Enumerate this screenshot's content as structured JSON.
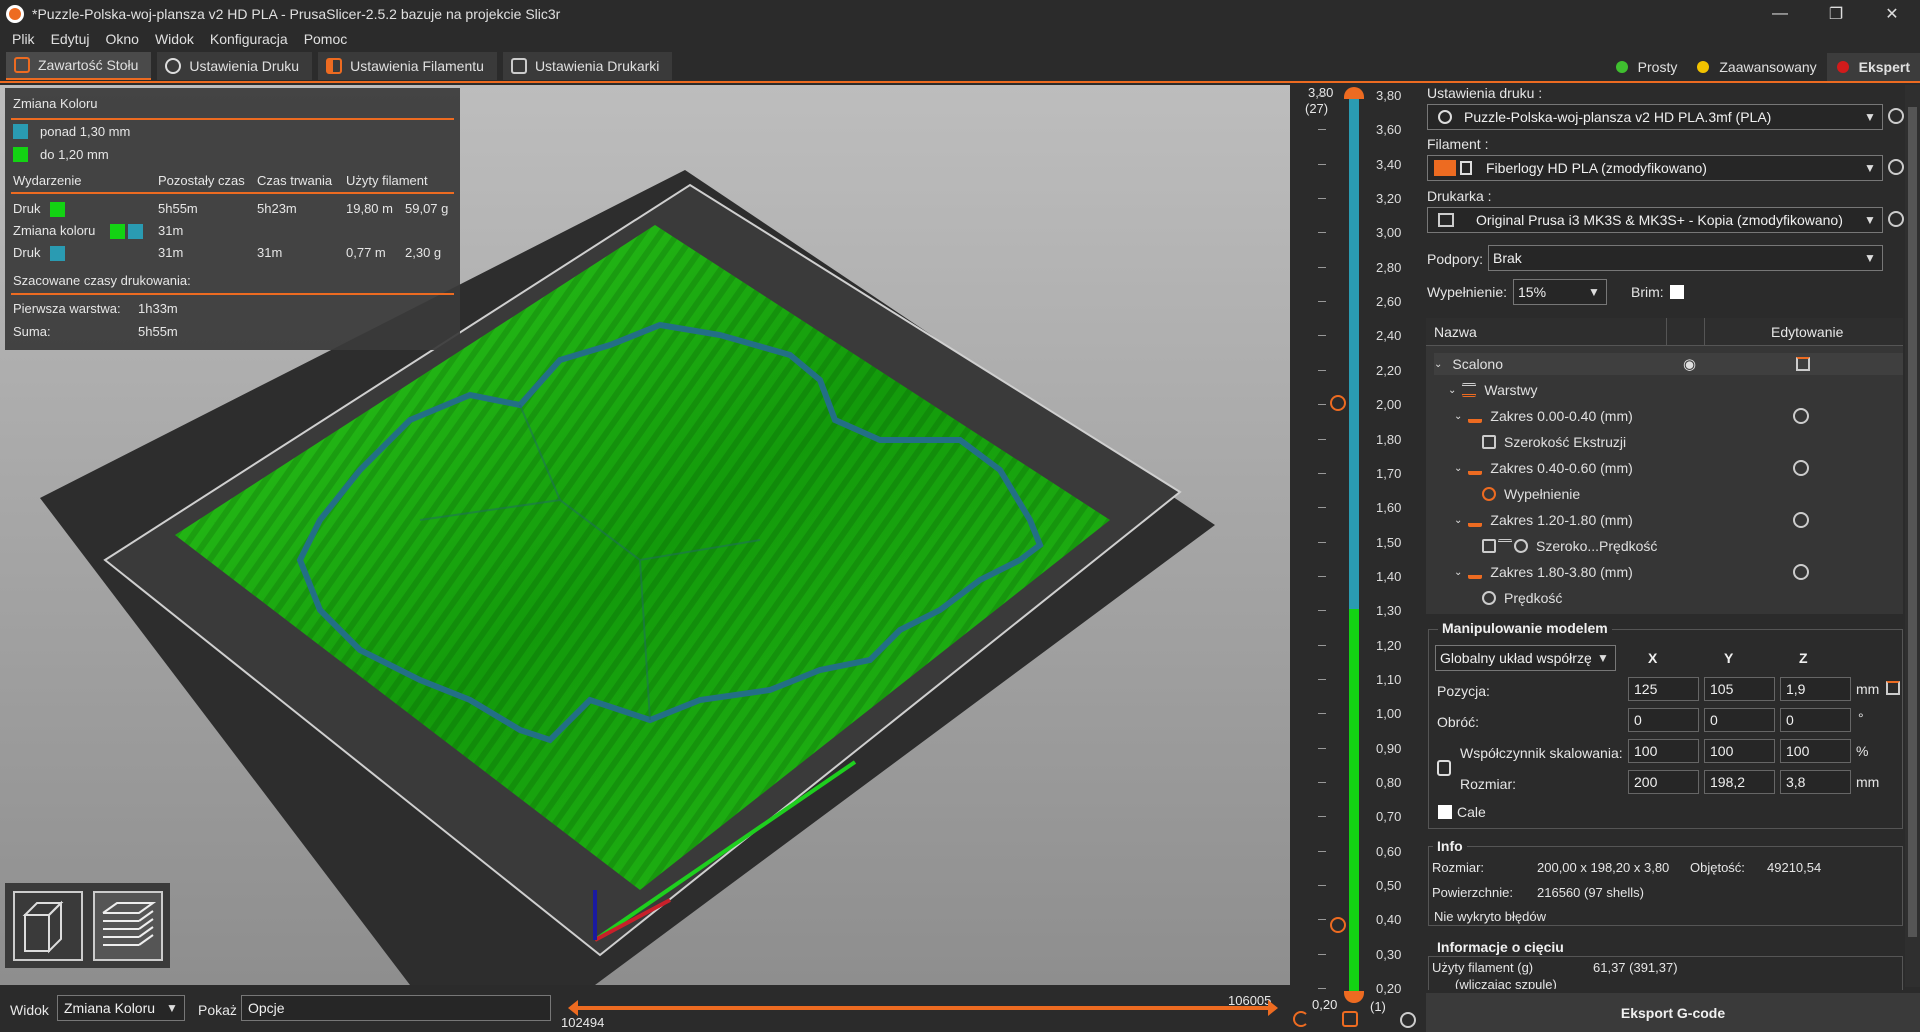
{
  "window": {
    "title": "*Puzzle-Polska-woj-plansza v2 HD PLA - PrusaSlicer-2.5.2 bazuje na projekcie Slic3r",
    "controls": [
      "—",
      "❐",
      "✕"
    ]
  },
  "menu": [
    "Plik",
    "Edytuj",
    "Okno",
    "Widok",
    "Konfiguracja",
    "Pomoc"
  ],
  "tabs": [
    "Zawartość Stołu",
    "Ustawienia Druku",
    "Ustawienia Filamentu",
    "Ustawienia Drukarki"
  ],
  "modes": [
    {
      "label": "Prosty",
      "color": "#3fbf2f"
    },
    {
      "label": "Zaawansowany",
      "color": "#f2c300"
    },
    {
      "label": "Ekspert",
      "color": "#d21b1b"
    }
  ],
  "legend": {
    "title": "Zmiana Koloru",
    "items": [
      {
        "label": "ponad 1,30 mm",
        "color": "#2a9bb2"
      },
      {
        "label": "do 1,20 mm",
        "color": "#13d313"
      }
    ],
    "headers": [
      "Wydarzenie",
      "Pozostały czas",
      "Czas trwania",
      "Użyty filament"
    ],
    "rows": [
      {
        "event": "Druk",
        "remaining": "5h55m",
        "duration": "5h23m",
        "len": "19,80 m",
        "weight": "59,07 g"
      },
      {
        "event": "Zmiana koloru",
        "remaining": "31m",
        "duration": "",
        "len": "",
        "weight": ""
      },
      {
        "event": "Druk",
        "remaining": "31m",
        "duration": "31m",
        "len": "0,77 m",
        "weight": "2,30 g"
      }
    ],
    "estimated_title": "Szacowane czasy drukowania:",
    "first_layer_label": "Pierwsza warstwa:",
    "first_layer_value": "1h33m",
    "total_label": "Suma:",
    "total_value": "5h55m"
  },
  "vertical_slider": {
    "top_value": "3,80",
    "top_layer": "(27)",
    "bottom_value": "0,20",
    "bottom_layer": "(1)",
    "ticks": [
      "3,80",
      "3,60",
      "3,40",
      "3,20",
      "3,00",
      "2,80",
      "2,60",
      "2,40",
      "2,20",
      "2,00",
      "1,80",
      "1,70",
      "1,60",
      "1,50",
      "1,40",
      "1,30",
      "1,20",
      "1,10",
      "1,00",
      "0,90",
      "0,80",
      "0,70",
      "0,60",
      "0,50",
      "0,40",
      "0,30",
      "0,20"
    ]
  },
  "bottom": {
    "view_label": "Widok",
    "view_value": "Zmiana Koloru",
    "show_label": "Pokaż",
    "show_value": "Opcje",
    "h_right_value": "106005",
    "h_left_value": "102494"
  },
  "right_panel": {
    "print_settings_label": "Ustawienia druku :",
    "print_settings_value": "Puzzle-Polska-woj-plansza v2 HD PLA.3mf (PLA)",
    "filament_label": "Filament :",
    "filament_value": "Fiberlogy HD PLA (zmodyfikowano)",
    "printer_label": "Drukarka :",
    "printer_value": "Original Prusa i3 MK3S & MK3S+ - Kopia (zmodyfikowano)",
    "supports_label": "Podpory:",
    "supports_value": "Brak",
    "infill_label": "Wypełnienie:",
    "infill_value": "15%",
    "brim_label": "Brim:"
  },
  "tree": {
    "col_name": "Nazwa",
    "col_edit": "Edytowanie",
    "rows": [
      {
        "label": "Scalono",
        "indent": 0
      },
      {
        "label": "Warstwy",
        "indent": 1
      },
      {
        "label": "Zakres 0.00-0.40 (mm)",
        "indent": 2
      },
      {
        "label": "Szerokość Ekstruzji",
        "indent": 3
      },
      {
        "label": "Zakres 0.40-0.60 (mm)",
        "indent": 2
      },
      {
        "label": "Wypełnienie",
        "indent": 3
      },
      {
        "label": "Zakres 1.20-1.80 (mm)",
        "indent": 2
      },
      {
        "label": "Szeroko...Prędkość",
        "indent": 3
      },
      {
        "label": "Zakres 1.80-3.80 (mm)",
        "indent": 2
      },
      {
        "label": "Prędkość",
        "indent": 3
      }
    ]
  },
  "manipulation": {
    "title": "Manipulowanie modelem",
    "coord_system": "Globalny układ współrzę",
    "axes": [
      "X",
      "Y",
      "Z"
    ],
    "position_label": "Pozycja:",
    "position": [
      "125",
      "105",
      "1,9"
    ],
    "position_unit": "mm",
    "rotation_label": "Obróć:",
    "rotation": [
      "0",
      "0",
      "0"
    ],
    "rotation_unit": "°",
    "scale_label": "Współczynnik skalowania:",
    "scale": [
      "100",
      "100",
      "100"
    ],
    "scale_unit": "%",
    "size_label": "Rozmiar:",
    "size": [
      "200",
      "198,2",
      "3,8"
    ],
    "size_unit": "mm",
    "inches_label": "Cale"
  },
  "info": {
    "title": "Info",
    "size_label": "Rozmiar:",
    "size_value": "200,00 x 198,20 x 3,80",
    "volume_label": "Objętość:",
    "volume_value": "49210,54",
    "facets_label": "Powierzchnie:",
    "facets_value": "216560 (97 shells)",
    "errors": "Nie wykryto błędów"
  },
  "slice_info": {
    "title": "Informacje o cięciu",
    "used_label": "Użyty filament (g)",
    "used_sub": "(wliczając szpulę)",
    "used_value": "61,37 (391,37)"
  },
  "export_label": "Eksport G-code"
}
